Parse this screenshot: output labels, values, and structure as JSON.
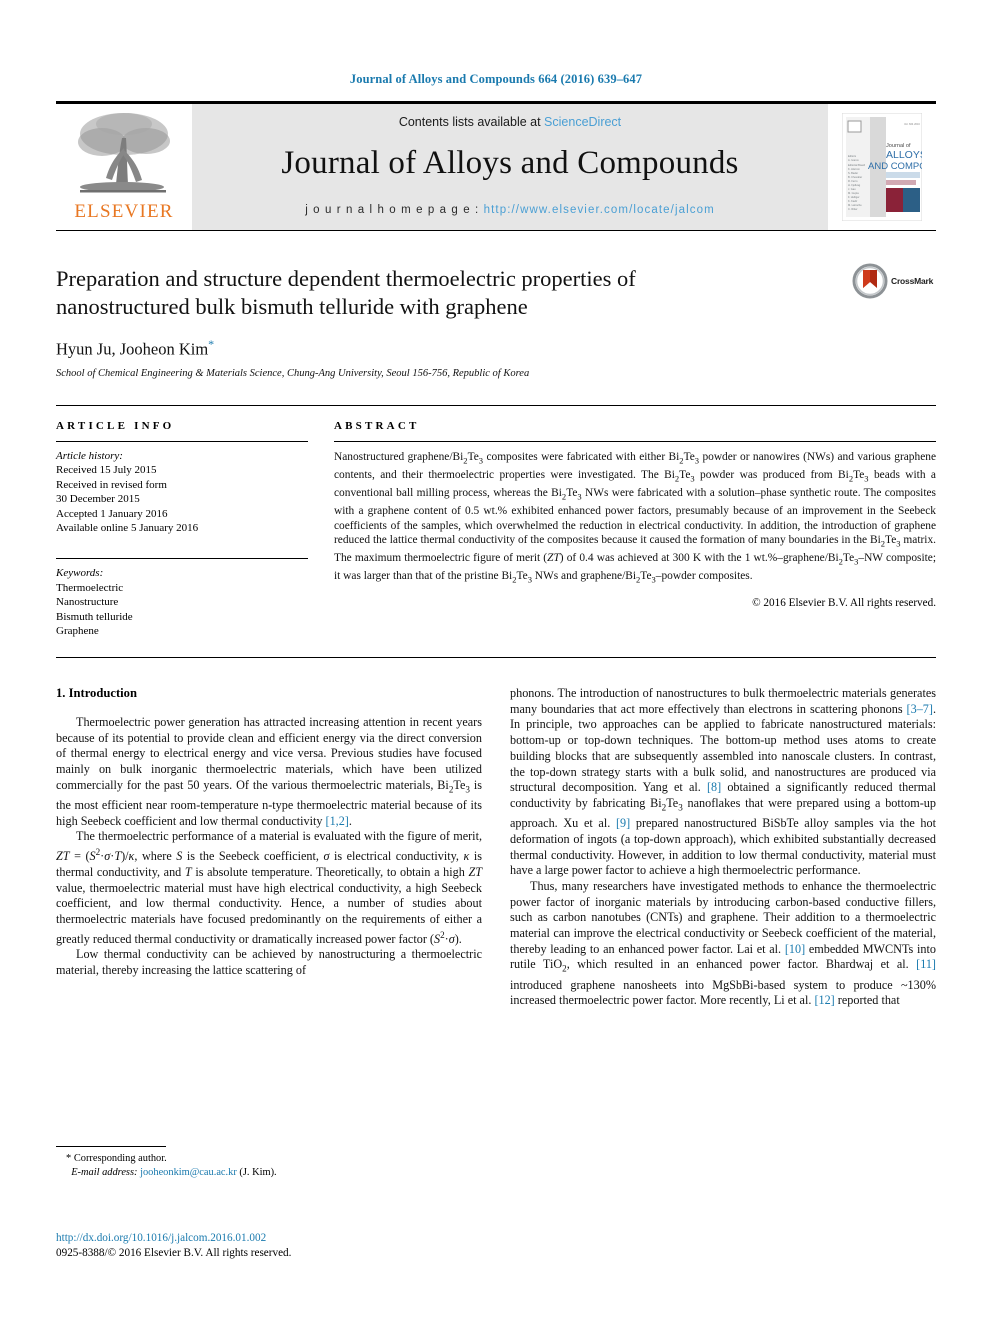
{
  "running_head": "Journal of Alloys and Compounds 664 (2016) 639–647",
  "masthead": {
    "contents_prefix": "Contents lists available at ",
    "sciencedirect": "ScienceDirect",
    "journal_name": "Journal of Alloys and Compounds",
    "homepage_label": "j o u r n a l   h o m e p a g e :   ",
    "homepage_url": "http://www.elsevier.com/locate/jalcom",
    "publisher": "ELSEVIER",
    "cover_title_1": "Journal of",
    "cover_title_2": "ALLOYS",
    "cover_title_3": "AND COMPOUNDS"
  },
  "title": {
    "line1": "Preparation and structure dependent thermoelectric properties of",
    "line2": "nanostructured bulk bismuth telluride with graphene",
    "authors": "Hyun Ju, Jooheon Kim",
    "corresponding_marker": "*",
    "affiliation": "School of Chemical Engineering & Materials Science, Chung-Ang University, Seoul 156-756, Republic of Korea",
    "crossmark_label": "CrossMark"
  },
  "article_info": {
    "heading": "ARTICLE INFO",
    "history_label": "Article history:",
    "history": [
      "Received 15 July 2015",
      "Received in revised form",
      "30 December 2015",
      "Accepted 1 January 2016",
      "Available online 5 January 2016"
    ],
    "keywords_label": "Keywords:",
    "keywords": [
      "Thermoelectric",
      "Nanostructure",
      "Bismuth telluride",
      "Graphene"
    ]
  },
  "abstract": {
    "heading": "ABSTRACT",
    "copyright": "© 2016 Elsevier B.V. All rights reserved."
  },
  "introduction": {
    "heading": "1.  Introduction",
    "left_paragraphs": [
      "Thermoelectric power generation has attracted increasing attention in recent years because of its potential to provide clean and efficient energy via the direct conversion of thermal energy to electrical energy and vice versa. Previous studies have focused mainly on bulk inorganic thermoelectric materials, which have been utilized commercially for the past 50 years. Of the various thermoelectric materials,"
    ]
  },
  "footnote": {
    "marker": "*",
    "corresponding": "Corresponding author.",
    "email_label": "E-mail address:",
    "email": "jooheonkim@cau.ac.kr",
    "email_suffix": "(J. Kim)."
  },
  "footer": {
    "doi": "http://dx.doi.org/10.1016/j.jalcom.2016.01.002",
    "issn_line": "0925-8388/© 2016 Elsevier B.V. All rights reserved."
  },
  "colors": {
    "link_blue": "#1a7aae",
    "sciencedirect_blue": "#4a9fd4",
    "elsevier_orange": "#E87722"
  }
}
